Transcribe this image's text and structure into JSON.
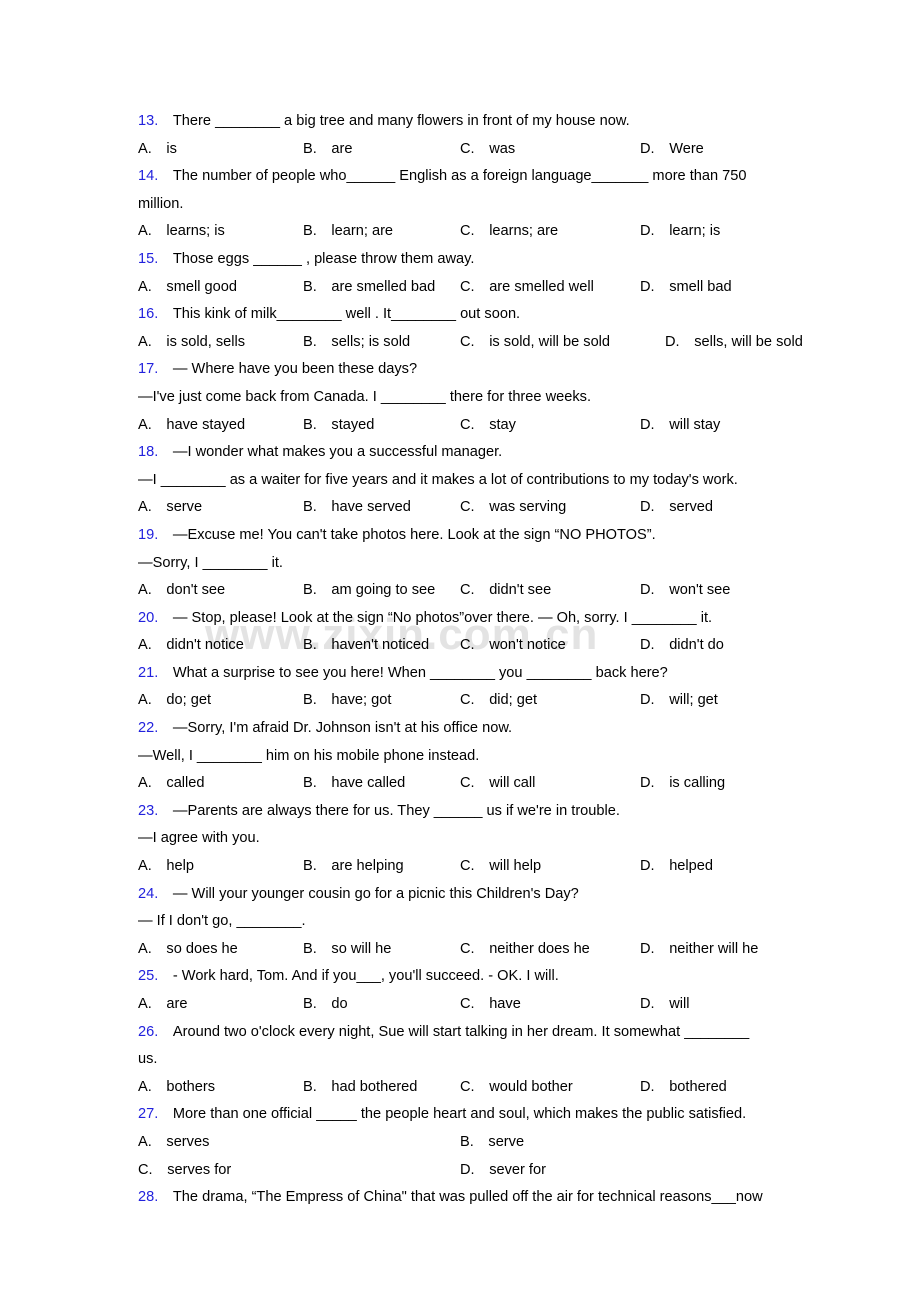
{
  "document": {
    "watermark": "www.zixin.com.cn",
    "number_color": "#2222dd",
    "text_color": "#000000",
    "background_color": "#ffffff"
  },
  "questions": [
    {
      "number": "13.",
      "lines": [
        "There ________ a big tree and many flowers in front of my house now."
      ],
      "options": [
        {
          "label": "A.",
          "text": "is"
        },
        {
          "label": "B.",
          "text": "are"
        },
        {
          "label": "C.",
          "text": "was"
        },
        {
          "label": "D.",
          "text": "Were"
        }
      ]
    },
    {
      "number": "14.",
      "lines": [
        "The number of people who______ English as a foreign language_______ more than 750",
        "million."
      ],
      "options": [
        {
          "label": "A.",
          "text": "learns; is"
        },
        {
          "label": "B.",
          "text": "learn; are"
        },
        {
          "label": "C.",
          "text": "learns; are"
        },
        {
          "label": "D.",
          "text": "learn; is"
        }
      ]
    },
    {
      "number": "15.",
      "lines": [
        "Those eggs ______ , please throw them away."
      ],
      "options": [
        {
          "label": "A.",
          "text": "smell good"
        },
        {
          "label": "B.",
          "text": "are smelled bad"
        },
        {
          "label": "C.",
          "text": "are smelled well"
        },
        {
          "label": "D.",
          "text": "smell bad"
        }
      ]
    },
    {
      "number": "16.",
      "lines": [
        "This kink of milk________ well . It________ out soon."
      ],
      "options": [
        {
          "label": "A.",
          "text": "is sold, sells"
        },
        {
          "label": "B.",
          "text": "sells; is sold"
        },
        {
          "label": "C.",
          "text": "is sold, will be sold"
        },
        {
          "label": "D.",
          "text": "sells, will be sold"
        }
      ]
    },
    {
      "number": "17.",
      "lines": [
        "— Where have you been these days?",
        "—I've just come back from Canada. I ________ there for three weeks."
      ],
      "options": [
        {
          "label": "A.",
          "text": "have stayed"
        },
        {
          "label": "B.",
          "text": "stayed"
        },
        {
          "label": "C.",
          "text": "stay"
        },
        {
          "label": "D.",
          "text": "will stay"
        }
      ]
    },
    {
      "number": "18.",
      "lines": [
        "—I wonder what makes you a successful manager.",
        "—I ________ as a waiter for five years and it makes a lot of contributions to my today's work."
      ],
      "options": [
        {
          "label": "A.",
          "text": "serve"
        },
        {
          "label": "B.",
          "text": "have served"
        },
        {
          "label": "C.",
          "text": "was serving"
        },
        {
          "label": "D.",
          "text": "served"
        }
      ]
    },
    {
      "number": "19.",
      "lines": [
        "—Excuse me! You can't take photos here. Look at the sign “NO PHOTOS”.",
        "—Sorry, I ________ it."
      ],
      "options": [
        {
          "label": "A.",
          "text": "don't see"
        },
        {
          "label": "B.",
          "text": "am going to see"
        },
        {
          "label": "C.",
          "text": "didn't see"
        },
        {
          "label": "D.",
          "text": "won't see"
        }
      ]
    },
    {
      "number": "20.",
      "lines": [
        "— Stop, please! Look at the sign “No photos”over there. — Oh, sorry. I ________ it."
      ],
      "options": [
        {
          "label": "A.",
          "text": "didn't notice"
        },
        {
          "label": "B.",
          "text": "haven't noticed"
        },
        {
          "label": "C.",
          "text": "won't notice"
        },
        {
          "label": "D.",
          "text": "didn't do"
        }
      ]
    },
    {
      "number": "21.",
      "lines": [
        "What a surprise to see you here! When ________ you ________ back here?"
      ],
      "options": [
        {
          "label": "A.",
          "text": "do; get"
        },
        {
          "label": "B.",
          "text": "have; got"
        },
        {
          "label": "C.",
          "text": "did; get"
        },
        {
          "label": "D.",
          "text": "will; get"
        }
      ]
    },
    {
      "number": "22.",
      "lines": [
        "—Sorry, I'm afraid Dr. Johnson isn't at his office now.",
        "—Well, I ________ him on his mobile phone instead."
      ],
      "options": [
        {
          "label": "A.",
          "text": "called"
        },
        {
          "label": "B.",
          "text": "have called"
        },
        {
          "label": "C.",
          "text": "will call"
        },
        {
          "label": "D.",
          "text": "is calling"
        }
      ]
    },
    {
      "number": "23.",
      "lines": [
        "—Parents are always there for us. They ______ us if we're in trouble.",
        "—I agree with you."
      ],
      "options": [
        {
          "label": "A.",
          "text": "help"
        },
        {
          "label": "B.",
          "text": "are helping"
        },
        {
          "label": "C.",
          "text": "will help"
        },
        {
          "label": "D.",
          "text": "helped"
        }
      ]
    },
    {
      "number": "24.",
      "lines": [
        "— Will your younger cousin go for a picnic this Children's Day?",
        "— If I don't go, ________."
      ],
      "options": [
        {
          "label": "A.",
          "text": "so does he"
        },
        {
          "label": "B.",
          "text": "so will he"
        },
        {
          "label": "C.",
          "text": "neither does he"
        },
        {
          "label": "D.",
          "text": "neither will he"
        }
      ]
    },
    {
      "number": "25.",
      "lines": [
        "- Work hard, Tom. And if you___, you'll succeed. - OK. I will."
      ],
      "options": [
        {
          "label": "A.",
          "text": "are"
        },
        {
          "label": "B.",
          "text": "do"
        },
        {
          "label": "C.",
          "text": "have"
        },
        {
          "label": "D.",
          "text": "will"
        }
      ]
    },
    {
      "number": "26.",
      "lines": [
        "Around two o'clock every night, Sue will start talking in her dream. It somewhat ________",
        "us."
      ],
      "options": [
        {
          "label": "A.",
          "text": "bothers"
        },
        {
          "label": "B.",
          "text": "had bothered"
        },
        {
          "label": "C.",
          "text": "would bother"
        },
        {
          "label": "D.",
          "text": "bothered"
        }
      ]
    },
    {
      "number": "27.",
      "lines": [
        "More than one official _____ the people heart and soul, which makes the public satisfied."
      ],
      "options": [
        {
          "label": "A.",
          "text": "serves"
        },
        {
          "label": "B.",
          "text": "serve"
        },
        {
          "label": "C.",
          "text": "serves for"
        },
        {
          "label": "D.",
          "text": "sever for"
        }
      ]
    },
    {
      "number": "28.",
      "lines": [
        "The drama, “The Empress of China\" that was pulled off the air for technical reasons___now"
      ],
      "options": []
    }
  ]
}
